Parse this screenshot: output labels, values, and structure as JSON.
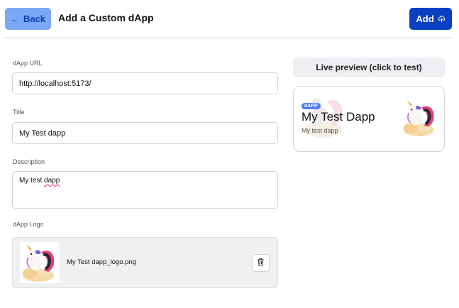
{
  "header": {
    "back_label": "Back",
    "title": "Add a Custom dApp",
    "add_label": "Add"
  },
  "form": {
    "url": {
      "label": "dApp URL",
      "value": "http://localhost:5173/"
    },
    "title": {
      "label": "Title",
      "value": "My Test dapp"
    },
    "description": {
      "label": "Description",
      "value_prefix": "My test ",
      "value_misspelled": "dapp"
    },
    "logo": {
      "label": "dApp Logo",
      "filename": "My Test dapp_logo.png"
    }
  },
  "preview": {
    "button_label": "Live preview (click to test)",
    "badge": "dAPP",
    "title": "My Test Dapp",
    "description": "My test dapp"
  },
  "colors": {
    "primary": "#0a3fc2",
    "back_bg": "#7ba7f7",
    "badge": "#4c7df0"
  },
  "icons": {
    "back": "arrow-left-icon",
    "add": "cloud-upload-icon",
    "delete": "trash-icon"
  }
}
